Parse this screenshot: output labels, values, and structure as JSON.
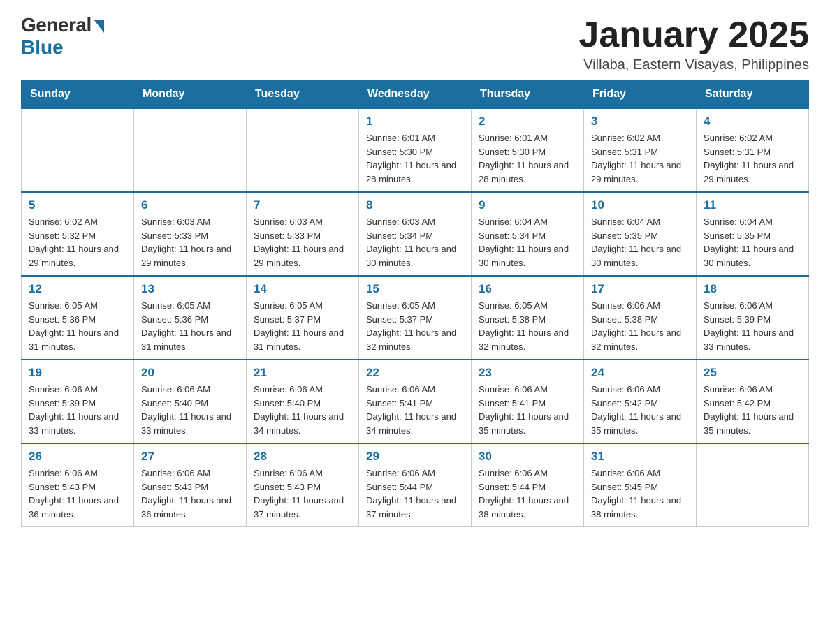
{
  "header": {
    "logo_general": "General",
    "logo_blue": "Blue",
    "month_title": "January 2025",
    "location": "Villaba, Eastern Visayas, Philippines"
  },
  "weekdays": [
    "Sunday",
    "Monday",
    "Tuesday",
    "Wednesday",
    "Thursday",
    "Friday",
    "Saturday"
  ],
  "weeks": [
    [
      {
        "day": "",
        "info": ""
      },
      {
        "day": "",
        "info": ""
      },
      {
        "day": "",
        "info": ""
      },
      {
        "day": "1",
        "info": "Sunrise: 6:01 AM\nSunset: 5:30 PM\nDaylight: 11 hours and 28 minutes."
      },
      {
        "day": "2",
        "info": "Sunrise: 6:01 AM\nSunset: 5:30 PM\nDaylight: 11 hours and 28 minutes."
      },
      {
        "day": "3",
        "info": "Sunrise: 6:02 AM\nSunset: 5:31 PM\nDaylight: 11 hours and 29 minutes."
      },
      {
        "day": "4",
        "info": "Sunrise: 6:02 AM\nSunset: 5:31 PM\nDaylight: 11 hours and 29 minutes."
      }
    ],
    [
      {
        "day": "5",
        "info": "Sunrise: 6:02 AM\nSunset: 5:32 PM\nDaylight: 11 hours and 29 minutes."
      },
      {
        "day": "6",
        "info": "Sunrise: 6:03 AM\nSunset: 5:33 PM\nDaylight: 11 hours and 29 minutes."
      },
      {
        "day": "7",
        "info": "Sunrise: 6:03 AM\nSunset: 5:33 PM\nDaylight: 11 hours and 29 minutes."
      },
      {
        "day": "8",
        "info": "Sunrise: 6:03 AM\nSunset: 5:34 PM\nDaylight: 11 hours and 30 minutes."
      },
      {
        "day": "9",
        "info": "Sunrise: 6:04 AM\nSunset: 5:34 PM\nDaylight: 11 hours and 30 minutes."
      },
      {
        "day": "10",
        "info": "Sunrise: 6:04 AM\nSunset: 5:35 PM\nDaylight: 11 hours and 30 minutes."
      },
      {
        "day": "11",
        "info": "Sunrise: 6:04 AM\nSunset: 5:35 PM\nDaylight: 11 hours and 30 minutes."
      }
    ],
    [
      {
        "day": "12",
        "info": "Sunrise: 6:05 AM\nSunset: 5:36 PM\nDaylight: 11 hours and 31 minutes."
      },
      {
        "day": "13",
        "info": "Sunrise: 6:05 AM\nSunset: 5:36 PM\nDaylight: 11 hours and 31 minutes."
      },
      {
        "day": "14",
        "info": "Sunrise: 6:05 AM\nSunset: 5:37 PM\nDaylight: 11 hours and 31 minutes."
      },
      {
        "day": "15",
        "info": "Sunrise: 6:05 AM\nSunset: 5:37 PM\nDaylight: 11 hours and 32 minutes."
      },
      {
        "day": "16",
        "info": "Sunrise: 6:05 AM\nSunset: 5:38 PM\nDaylight: 11 hours and 32 minutes."
      },
      {
        "day": "17",
        "info": "Sunrise: 6:06 AM\nSunset: 5:38 PM\nDaylight: 11 hours and 32 minutes."
      },
      {
        "day": "18",
        "info": "Sunrise: 6:06 AM\nSunset: 5:39 PM\nDaylight: 11 hours and 33 minutes."
      }
    ],
    [
      {
        "day": "19",
        "info": "Sunrise: 6:06 AM\nSunset: 5:39 PM\nDaylight: 11 hours and 33 minutes."
      },
      {
        "day": "20",
        "info": "Sunrise: 6:06 AM\nSunset: 5:40 PM\nDaylight: 11 hours and 33 minutes."
      },
      {
        "day": "21",
        "info": "Sunrise: 6:06 AM\nSunset: 5:40 PM\nDaylight: 11 hours and 34 minutes."
      },
      {
        "day": "22",
        "info": "Sunrise: 6:06 AM\nSunset: 5:41 PM\nDaylight: 11 hours and 34 minutes."
      },
      {
        "day": "23",
        "info": "Sunrise: 6:06 AM\nSunset: 5:41 PM\nDaylight: 11 hours and 35 minutes."
      },
      {
        "day": "24",
        "info": "Sunrise: 6:06 AM\nSunset: 5:42 PM\nDaylight: 11 hours and 35 minutes."
      },
      {
        "day": "25",
        "info": "Sunrise: 6:06 AM\nSunset: 5:42 PM\nDaylight: 11 hours and 35 minutes."
      }
    ],
    [
      {
        "day": "26",
        "info": "Sunrise: 6:06 AM\nSunset: 5:43 PM\nDaylight: 11 hours and 36 minutes."
      },
      {
        "day": "27",
        "info": "Sunrise: 6:06 AM\nSunset: 5:43 PM\nDaylight: 11 hours and 36 minutes."
      },
      {
        "day": "28",
        "info": "Sunrise: 6:06 AM\nSunset: 5:43 PM\nDaylight: 11 hours and 37 minutes."
      },
      {
        "day": "29",
        "info": "Sunrise: 6:06 AM\nSunset: 5:44 PM\nDaylight: 11 hours and 37 minutes."
      },
      {
        "day": "30",
        "info": "Sunrise: 6:06 AM\nSunset: 5:44 PM\nDaylight: 11 hours and 38 minutes."
      },
      {
        "day": "31",
        "info": "Sunrise: 6:06 AM\nSunset: 5:45 PM\nDaylight: 11 hours and 38 minutes."
      },
      {
        "day": "",
        "info": ""
      }
    ]
  ]
}
